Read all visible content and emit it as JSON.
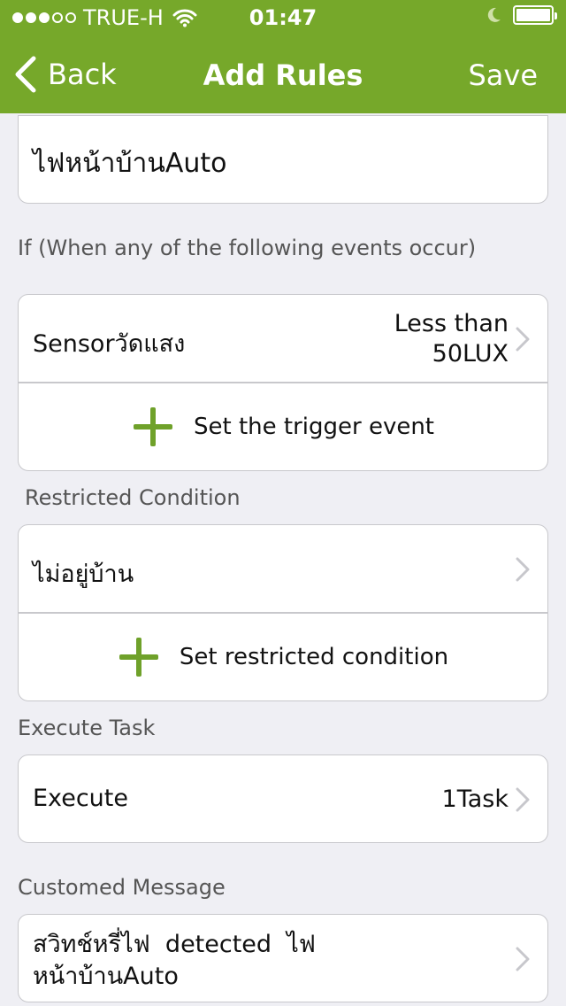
{
  "status_bar": {
    "carrier": "TRUE-H",
    "time": "01:47",
    "signal_bars_filled": 3,
    "signal_bars_total": 5
  },
  "nav": {
    "back_label": "Back",
    "title": "Add Rules",
    "save_label": "Save"
  },
  "rule_name": {
    "value": "ไฟหน้าบ้านAuto"
  },
  "if_section": {
    "label": "If (When any of the following events occur)",
    "trigger": {
      "label": "Sensorวัดแสง",
      "value_line1": "Less than",
      "value_line2": "50LUX"
    },
    "add_label": "Set the trigger event"
  },
  "restricted_section": {
    "label": "Restricted Condition",
    "condition": {
      "label": "ไม่อยู่บ้าน"
    },
    "add_label": "Set restricted condition"
  },
  "execute_section": {
    "label": "Execute Task",
    "row": {
      "label": "Execute",
      "value": "1Task"
    }
  },
  "message_section": {
    "label": "Customed Message",
    "line1": "สวิทช์หรี่ไฟ  detected  ไฟ",
    "line2": "หน้าบ้านAuto"
  },
  "colors": {
    "accent": "#76a82a",
    "background": "#efeff4",
    "chevron": "#c7c7cc"
  }
}
